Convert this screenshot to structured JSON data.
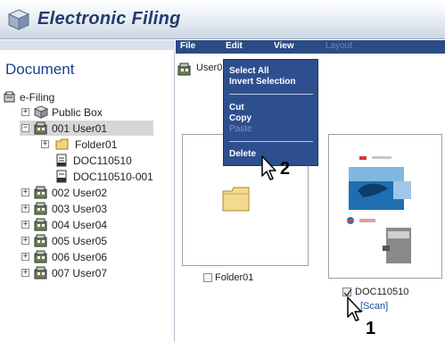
{
  "header": {
    "app_title": "Electronic Filing"
  },
  "left": {
    "heading": "Document",
    "tree": {
      "root": "e-Filing",
      "public_box": "Public Box",
      "user01": "001 User01",
      "folder01": "Folder01",
      "doc1": "DOC110510",
      "doc2": "DOC110510-001",
      "user02": "002 User02",
      "user03": "003 User03",
      "user04": "004 User04",
      "user05": "005 User05",
      "user06": "006 User06",
      "user07": "007 User07"
    }
  },
  "menubar": {
    "file": "File",
    "edit": "Edit",
    "view": "View",
    "layout": "Layout"
  },
  "breadcrumb": "User0",
  "edit_menu": {
    "select_all": "Select All",
    "invert_selection": "Invert Selection",
    "cut": "Cut",
    "copy": "Copy",
    "paste": "Paste",
    "delete": "Delete"
  },
  "items": {
    "folder_label": "Folder01",
    "doc_label": "DOC110510",
    "doc_tag": "[Scan]"
  },
  "steps": {
    "step1": "1",
    "step2": "2"
  }
}
